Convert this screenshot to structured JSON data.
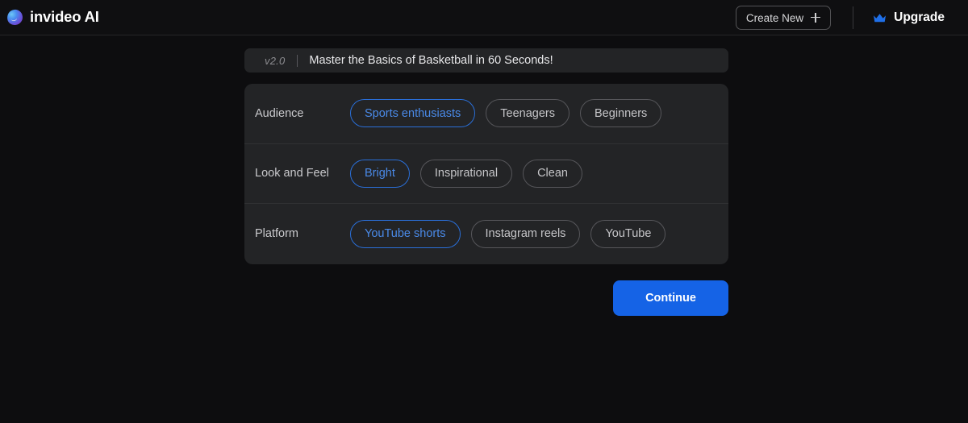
{
  "header": {
    "brand_name": "invideo AI",
    "logo_icon": "invideo-blob-logo-icon",
    "create_new_label": "Create New",
    "plus_icon": "plus-icon",
    "upgrade_label": "Upgrade",
    "crown_icon": "crown-icon"
  },
  "colors": {
    "page_background": "#0d0d0f",
    "card_background": "#232426",
    "accent_blue": "#1563e6",
    "selected_pill_border": "#2a6fd8",
    "selected_pill_text": "#4a8ae8",
    "unselected_pill_border": "#56565a"
  },
  "title_bar": {
    "version": "v2.0",
    "title": "Master the Basics of Basketball in 60 Seconds!"
  },
  "options": [
    {
      "label": "Audience",
      "choices": [
        {
          "label": "Sports enthusiasts",
          "selected": true
        },
        {
          "label": "Teenagers",
          "selected": false
        },
        {
          "label": "Beginners",
          "selected": false
        }
      ]
    },
    {
      "label": "Look and Feel",
      "choices": [
        {
          "label": "Bright",
          "selected": true
        },
        {
          "label": "Inspirational",
          "selected": false
        },
        {
          "label": "Clean",
          "selected": false
        }
      ]
    },
    {
      "label": "Platform",
      "choices": [
        {
          "label": "YouTube shorts",
          "selected": true
        },
        {
          "label": "Instagram reels",
          "selected": false
        },
        {
          "label": "YouTube",
          "selected": false
        }
      ]
    }
  ],
  "footer": {
    "continue_label": "Continue"
  }
}
